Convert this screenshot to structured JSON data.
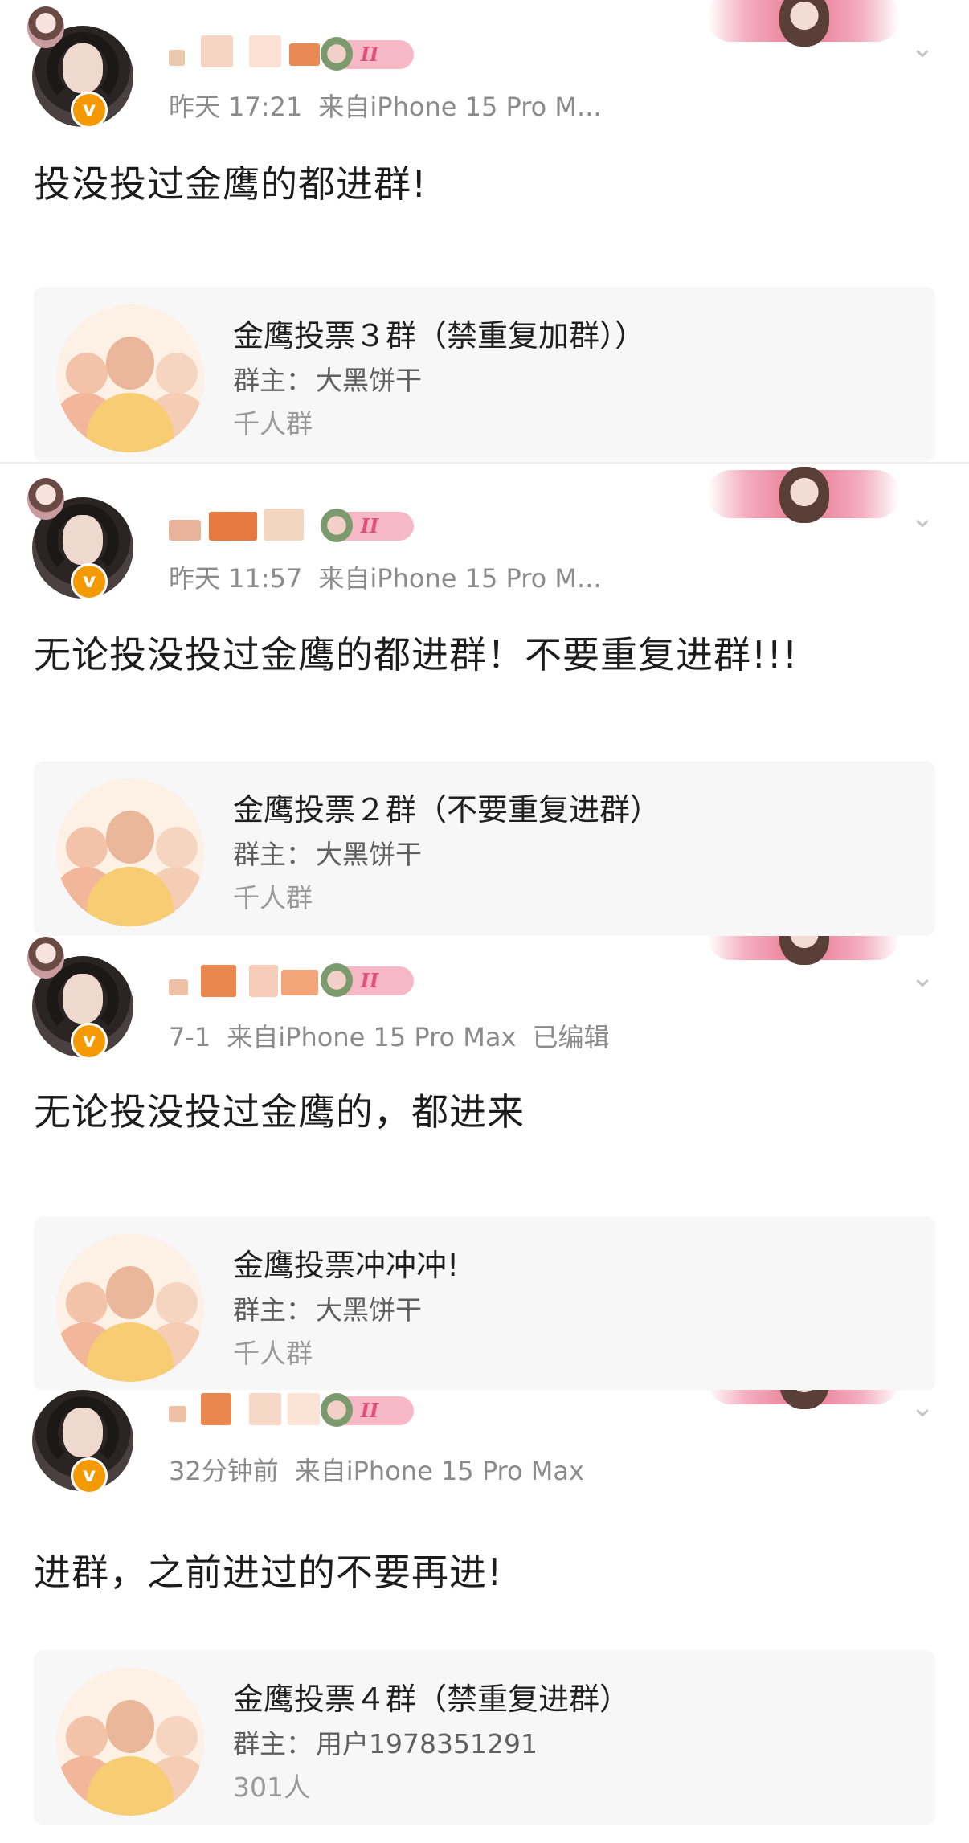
{
  "posts": [
    {
      "meta_time": "昨天 17:21",
      "meta_source": "来自iPhone 15 Pro M...",
      "meta_edited": "",
      "text": "投没投过金鹰的都进群!",
      "group_card": {
        "title": "金鹰投票３群（禁重复加群））",
        "owner_label": "群主：",
        "owner_name": "大黑饼干",
        "member_count": "千人群"
      }
    },
    {
      "meta_time": "昨天 11:57",
      "meta_source": "来自iPhone 15 Pro M...",
      "meta_edited": "",
      "text": "无论投没投过金鹰的都进群！不要重复进群!!!",
      "group_card": {
        "title": "金鹰投票２群（不要重复进群）",
        "owner_label": "群主：",
        "owner_name": "大黑饼干",
        "member_count": "千人群"
      }
    },
    {
      "meta_time": "7-1",
      "meta_source": "来自iPhone 15 Pro Max",
      "meta_edited": "已编辑",
      "text": "无论投没投过金鹰的，都进来",
      "group_card": {
        "title": "金鹰投票冲冲冲!",
        "owner_label": "群主：",
        "owner_name": "大黑饼干",
        "member_count": "千人群"
      }
    },
    {
      "meta_time": "32分钟前",
      "meta_source": "来自iPhone 15 Pro Max",
      "meta_edited": "",
      "text": "进群，之前进过的不要再进!",
      "group_card": {
        "title": "金鹰投票４群（禁重复进群）",
        "owner_label": "群主：",
        "owner_name": "用户1978351291",
        "member_count": "301人"
      }
    }
  ],
  "badge_text": "II",
  "verified_mark": "v",
  "icons": {
    "avatar": "user-avatar-icon",
    "verified": "verified-badge-icon",
    "fan_badge": "fan-level-badge-icon",
    "banner": "profile-banner-decoration",
    "chevron": "chevron-down-icon",
    "group": "group-chat-icon"
  },
  "colors": {
    "verified": "#f49a00",
    "badge_bg": "#f7b8c6",
    "badge_fg": "#e0507a",
    "card_bg": "#f7f7f7",
    "meta_text": "#8b8b8b"
  }
}
